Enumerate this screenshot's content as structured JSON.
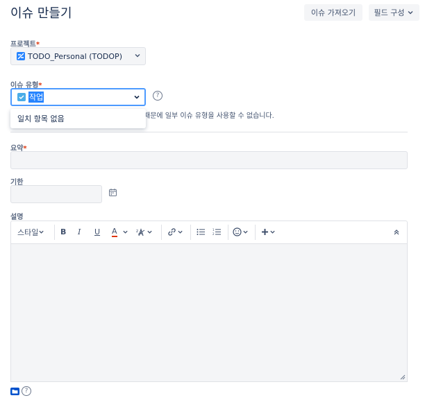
{
  "header": {
    "title": "이슈 만들기",
    "import_button": "이슈 가져오기",
    "configure_fields_button": "필드 구성"
  },
  "project": {
    "label": "프로젝트",
    "value": "TODO_Personal (TODOP)"
  },
  "issue_type": {
    "label": "이슈 유형",
    "value": "작업",
    "dropdown_message": "일치 항목 없음",
    "notice_partial": "때문에 일부 이슈 유형을 사용할 수 없습니다."
  },
  "summary": {
    "label": "요약"
  },
  "due_date": {
    "label": "기한"
  },
  "description": {
    "label": "설명",
    "toolbar": {
      "style_label": "스타일",
      "bold": "B",
      "italic": "I",
      "underline": "U",
      "text_color": "A"
    }
  },
  "colors": {
    "accent": "#4c9aff",
    "required": "#de350b",
    "text_color_underline": "#de350b"
  }
}
